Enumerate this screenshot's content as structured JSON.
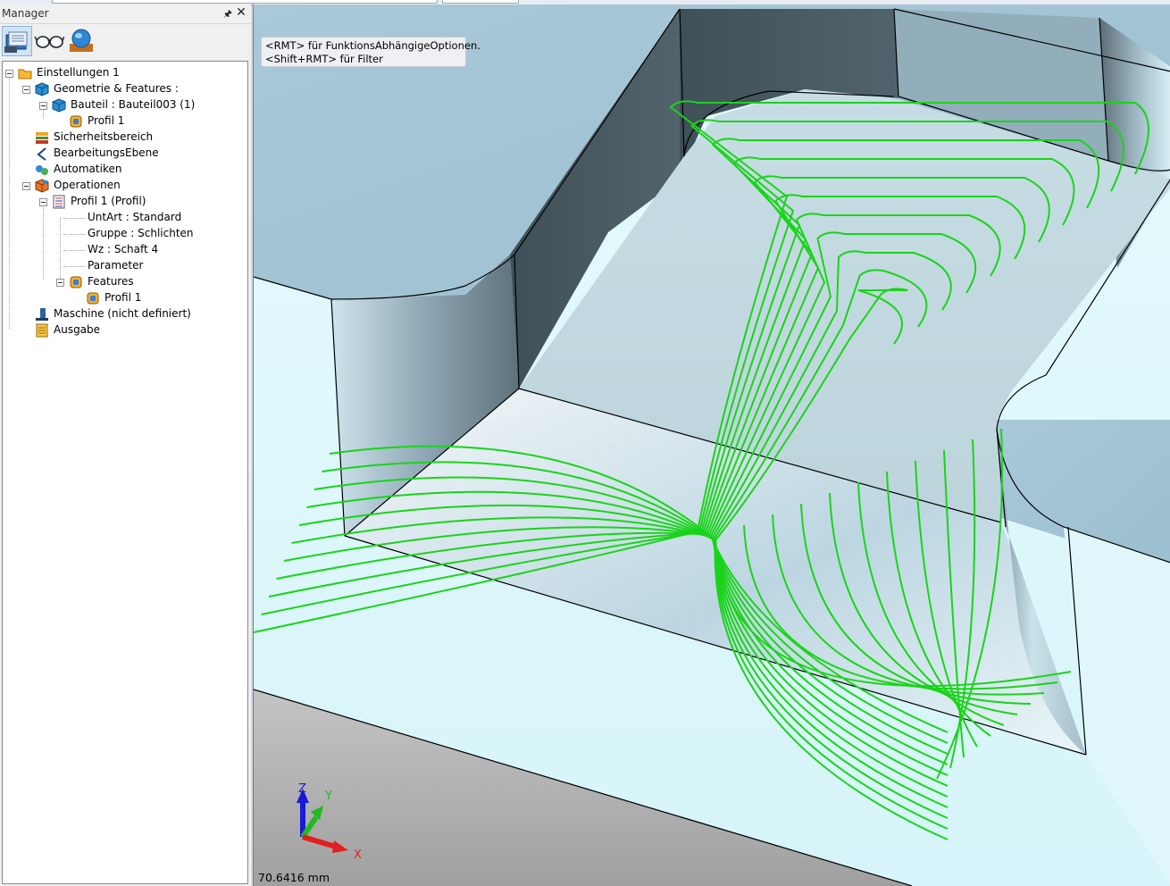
{
  "manager": {
    "title": "Manager",
    "pin_icon": "pin-icon",
    "close_icon": "close-icon",
    "toolbar": [
      "project-tree-icon",
      "view-glasses-icon",
      "simulation-globe-icon"
    ]
  },
  "tree": {
    "einstellungen": "Einstellungen 1",
    "geometrie": "Geometrie & Features :",
    "bauteil": "Bauteil : Bauteil003 (1)",
    "profil_geo": "Profil 1",
    "sicherheit": "Sicherheitsbereich",
    "bearbeitungsebene": "BearbeitungsEbene",
    "automatiken": "Automatiken",
    "operationen": "Operationen",
    "profil_op": "Profil 1 (Profil)",
    "untart": "UntArt : Standard",
    "gruppe": "Gruppe : Schlichten",
    "wz": "Wz : Schaft 4",
    "parameter": "Parameter",
    "features": "Features",
    "profil_feat": "Profil 1",
    "maschine": "Maschine (nicht definiert)",
    "ausgabe": "Ausgabe"
  },
  "viewport": {
    "hint_line1": "<RMT> für FunktionsAbhängigeOptionen.",
    "hint_line2": "<Shift+RMT> für Filter",
    "axis_z": "Z",
    "axis_y": "Y",
    "axis_x": "X",
    "measure": "70.6416 mm",
    "toolpath_color": "#19d419"
  }
}
